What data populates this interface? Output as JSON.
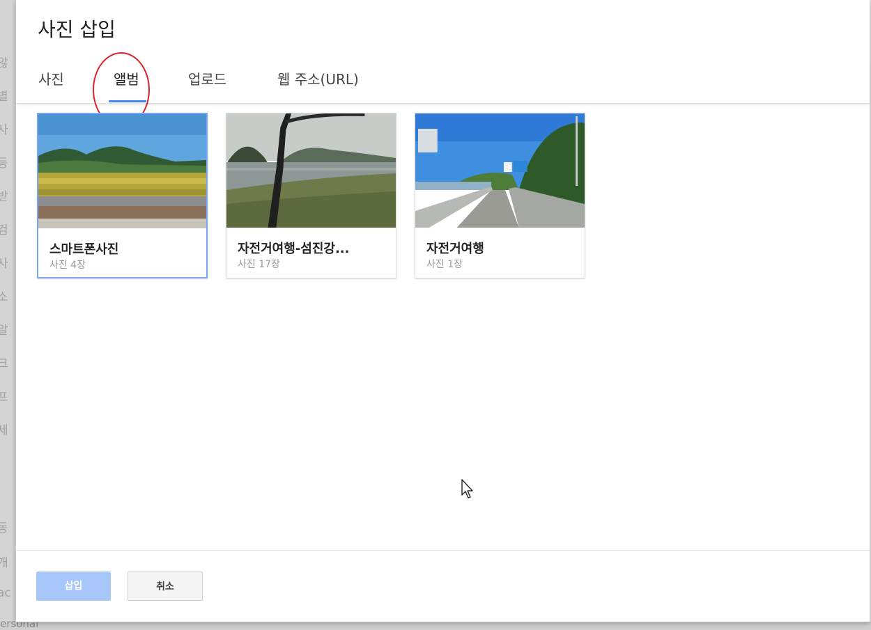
{
  "dialog": {
    "title": "사진 삽입"
  },
  "tabs": [
    {
      "label": "사진"
    },
    {
      "label": "앨범"
    },
    {
      "label": "업로드"
    },
    {
      "label": "웹 주소(URL)"
    }
  ],
  "albums": [
    {
      "title": "스마트폰사진",
      "count": "사진 4장"
    },
    {
      "title": "자전거여행-섬진강...",
      "count": "사진 17장"
    },
    {
      "title": "자전거여행",
      "count": "사진 1장"
    }
  ],
  "buttons": {
    "insert": "삽입",
    "cancel": "취소"
  },
  "background": {
    "chars": [
      "않",
      "별",
      "사",
      "등",
      "받",
      "검",
      "사",
      "소",
      "알",
      "크",
      "프",
      "세",
      "동",
      "개",
      "ac"
    ],
    "bottom_word": "ersonal"
  },
  "colors": {
    "accent": "#4285f4",
    "annotation": "#d9232f",
    "insert_button": "#a7c7fa"
  }
}
